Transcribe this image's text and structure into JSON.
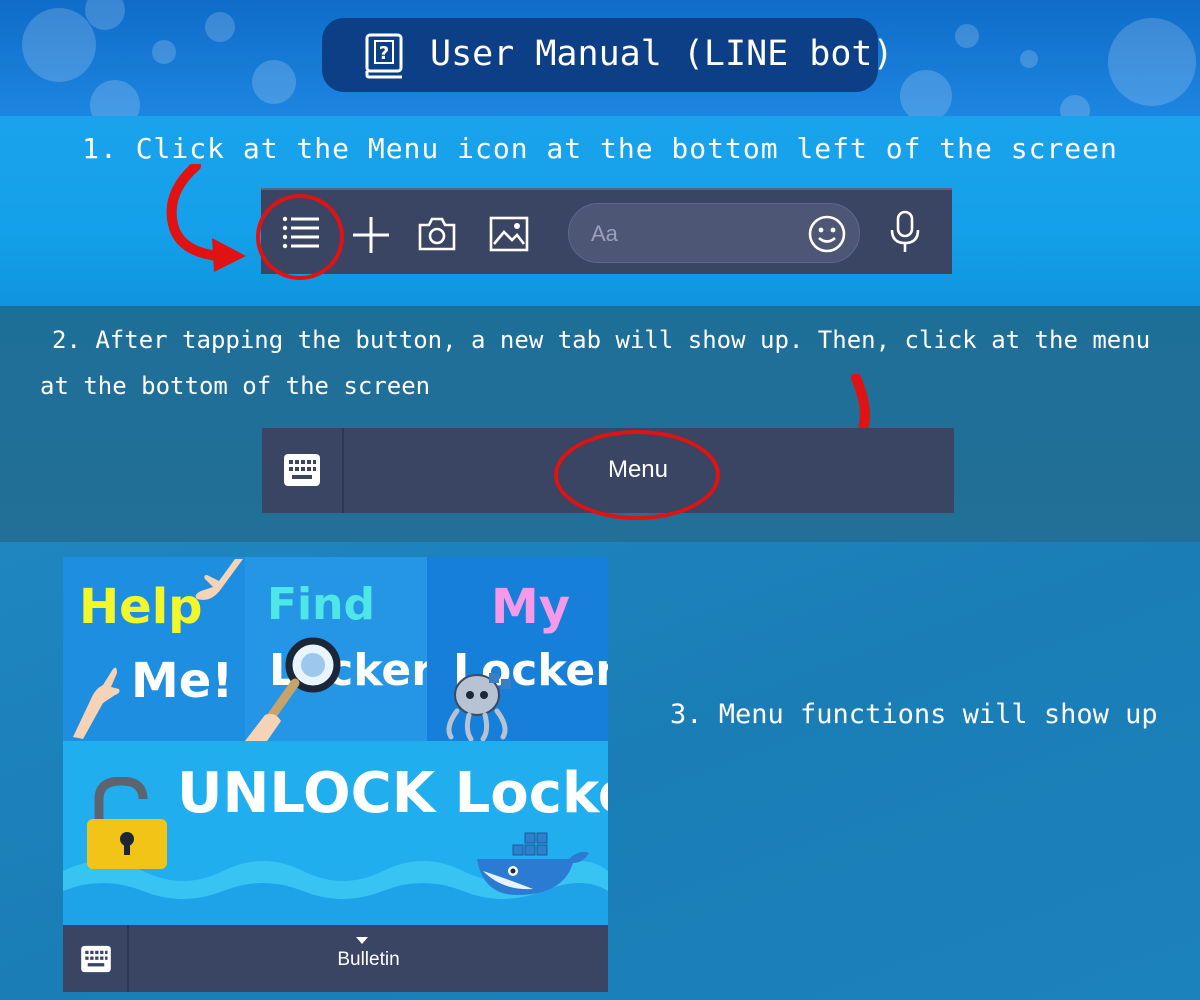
{
  "header": {
    "title": "User Manual (LINE bot)",
    "icon": "help-book-icon",
    "accent": "#0d3f86"
  },
  "step1": {
    "text": "1. Click at the Menu icon at the bottom left of the screen",
    "toolbar": {
      "icons": [
        "menu-list-icon",
        "plus-icon",
        "camera-icon",
        "image-icon",
        "emoji-icon",
        "microphone-icon"
      ],
      "input_placeholder": "Aa"
    }
  },
  "step2": {
    "line1": "2. After tapping the button, a new tab will show up. Then, click at the menu",
    "line2": "at the bottom of the screen",
    "menubar": {
      "label": "Menu",
      "icon": "keyboard-icon"
    }
  },
  "step3": {
    "text": "3. Menu functions will show up",
    "richmenu": {
      "help": {
        "line1": "Help",
        "line2": "Me!"
      },
      "find": {
        "line1": "Find",
        "line2": "Locker"
      },
      "my": {
        "line1": "My",
        "line2": "Locker"
      },
      "unlock": {
        "label": "UNLOCK Locker"
      },
      "bar": {
        "label": "Bulletin"
      }
    }
  },
  "colors": {
    "highlight": "#e01212",
    "bar": "#3a4463"
  }
}
